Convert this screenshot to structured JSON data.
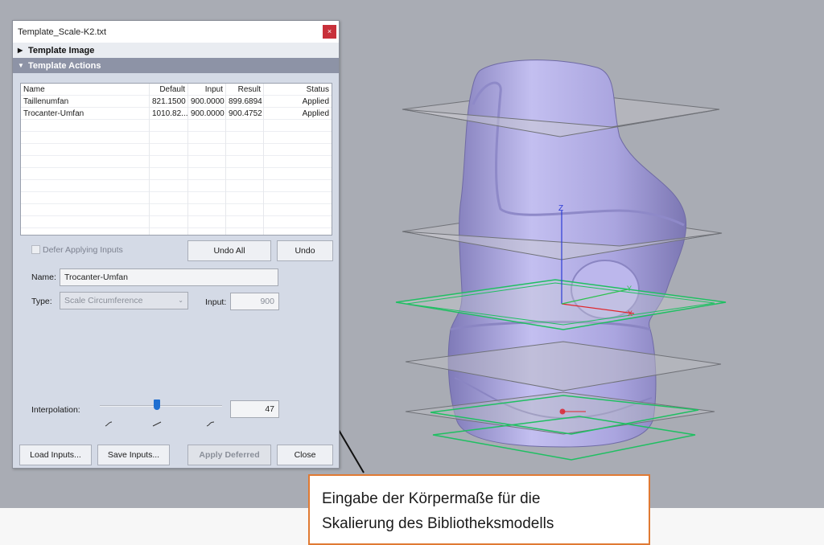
{
  "window": {
    "title": "Template_Scale-K2.txt",
    "close_glyph": "×"
  },
  "sections": {
    "template_image": "Template Image",
    "template_actions": "Template Actions"
  },
  "table": {
    "headers": [
      "Name",
      "Default",
      "Input",
      "Result",
      "Status"
    ],
    "rows": [
      [
        "Taillenumfan",
        "821.1500",
        "900.0000",
        "899.6894",
        "Applied"
      ],
      [
        "Trocanter-Umfan",
        "1010.82...",
        "900.0000",
        "900.4752",
        "Applied"
      ]
    ]
  },
  "controls": {
    "defer_label": "Defer Applying Inputs",
    "undo_all": "Undo All",
    "undo": "Undo",
    "name_label": "Name:",
    "name_value": "Trocanter-Umfan",
    "type_label": "Type:",
    "type_value": "Scale Circumference",
    "input_label": "Input:",
    "input_value": "900",
    "interpolation_label": "Interpolation:",
    "interpolation_value": "47",
    "interpolation_level": 0.47
  },
  "buttons": {
    "load_inputs": "Load Inputs...",
    "save_inputs": "Save Inputs...",
    "apply_deferred": "Apply Deferred",
    "close": "Close"
  },
  "axes": {
    "z": "Z",
    "y": "Y",
    "x": "X"
  },
  "callout": {
    "line1": "Eingabe der Körpermaße für die",
    "line2": "Skalierung des Bibliotheksmodells"
  },
  "colors": {
    "viewport_bg": "#a9acb4",
    "model_fill": "#b0abe3",
    "plane_green": "#1fbf62",
    "callout_border": "#e07a33",
    "close_red": "#c8303a"
  }
}
